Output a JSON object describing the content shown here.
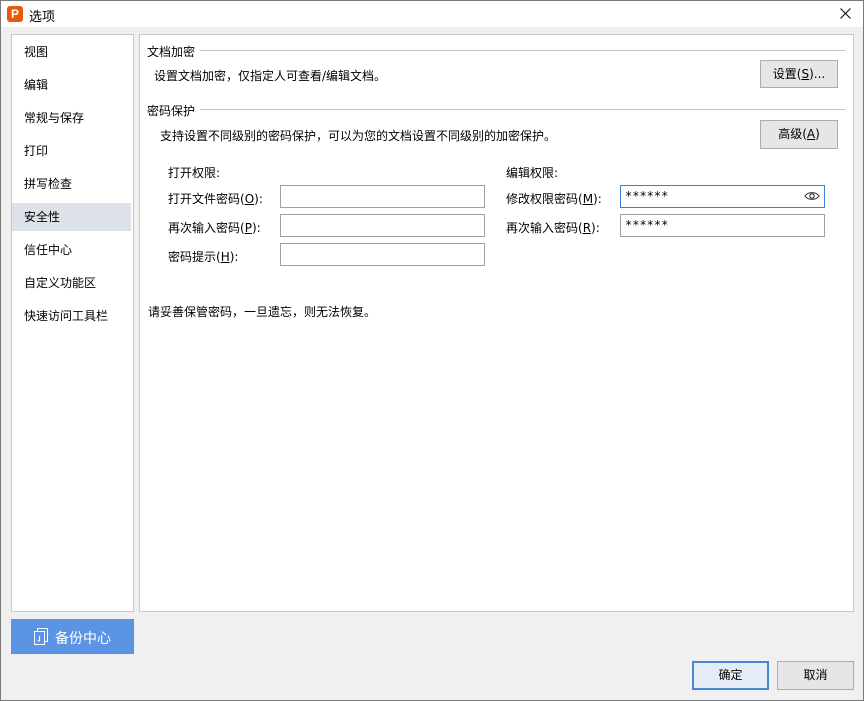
{
  "window": {
    "title": "选项",
    "app_icon_letter": "P"
  },
  "sidebar": {
    "items": [
      {
        "label": "视图"
      },
      {
        "label": "编辑"
      },
      {
        "label": "常规与保存"
      },
      {
        "label": "打印"
      },
      {
        "label": "拼写检查"
      },
      {
        "label": "安全性"
      },
      {
        "label": "信任中心"
      },
      {
        "label": "自定义功能区"
      },
      {
        "label": "快速访问工具栏"
      }
    ],
    "active": "安全性"
  },
  "backup": {
    "label": "备份中心"
  },
  "encryption": {
    "title": "文档加密",
    "description": "设置文档加密，仅指定人可查看/编辑文档。",
    "settings_button": {
      "text": "设置(",
      "key": "S",
      "suffix": ")..."
    }
  },
  "password_protection": {
    "title": "密码保护",
    "description": "支持设置不同级别的密码保护，可以为您的文档设置不同级别的加密保护。",
    "advanced_button": {
      "text": "高级(",
      "key": "A",
      "suffix": ")"
    },
    "open_perm": {
      "heading": "打开权限:",
      "open_password": {
        "text": "打开文件密码(",
        "key": "O",
        "suffix": "):",
        "value": ""
      },
      "reenter_password": {
        "text": "再次输入密码(",
        "key": "P",
        "suffix": "):",
        "value": ""
      },
      "hint": {
        "text": "密码提示(",
        "key": "H",
        "suffix": "):",
        "value": ""
      }
    },
    "edit_perm": {
      "heading": "编辑权限:",
      "modify_password": {
        "text": "修改权限密码(",
        "key": "M",
        "suffix": "):",
        "value": "******"
      },
      "reenter_password": {
        "text": "再次输入密码(",
        "key": "R",
        "suffix": "):",
        "value": "******"
      }
    },
    "warning": "请妥善保管密码，一旦遗忘，则无法恢复。"
  },
  "footer": {
    "ok_label": "确定",
    "cancel_label": "取消"
  },
  "colors": {
    "accent": "#5b94e4",
    "focus_border": "#3b7ddd",
    "active_sidebar": "#dde1e8",
    "app_icon": "#e8590c"
  }
}
